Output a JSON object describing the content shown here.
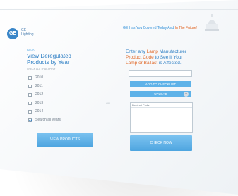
{
  "header": {
    "logo_text": "GE",
    "brand_line1": "GE",
    "brand_line2": "Lighting",
    "tagline_part1": "GE Has You Covered Today And",
    "tagline_part2": "In The Future!"
  },
  "left": {
    "step": "BACK",
    "title_line1": "View Deregulated",
    "title_line2": "Products by Year",
    "hint": "CHECK ALL THAT APPLY",
    "years": [
      {
        "label": "2010",
        "checked": false
      },
      {
        "label": "2011",
        "checked": false
      },
      {
        "label": "2012",
        "checked": false
      },
      {
        "label": "2013",
        "checked": false
      },
      {
        "label": "2014",
        "checked": false
      },
      {
        "label": "Search all years",
        "checked": true
      }
    ],
    "view_button": "VIEW PRODUCTS"
  },
  "divider_or": "OR",
  "right": {
    "title_line1_a": "Enter any",
    "title_line1_b": "Lamp",
    "title_line1_c": "Manufacturer",
    "title_line2_a": "Product Code",
    "title_line2_b": "to See If Your",
    "title_line3_a": "Lamp or Ballast",
    "title_line3_b": "is Affected.",
    "input_value": "",
    "add_button": "ADD TO CHECKLIST",
    "upload_button": "UPLOAD",
    "help_icon": "?",
    "code_header": "Product Code",
    "check_button": "CHECK NOW"
  },
  "colors": {
    "accent_blue": "#2e7fc4",
    "button_blue": "#5eb2e8",
    "highlight_orange": "#e06a2a"
  }
}
